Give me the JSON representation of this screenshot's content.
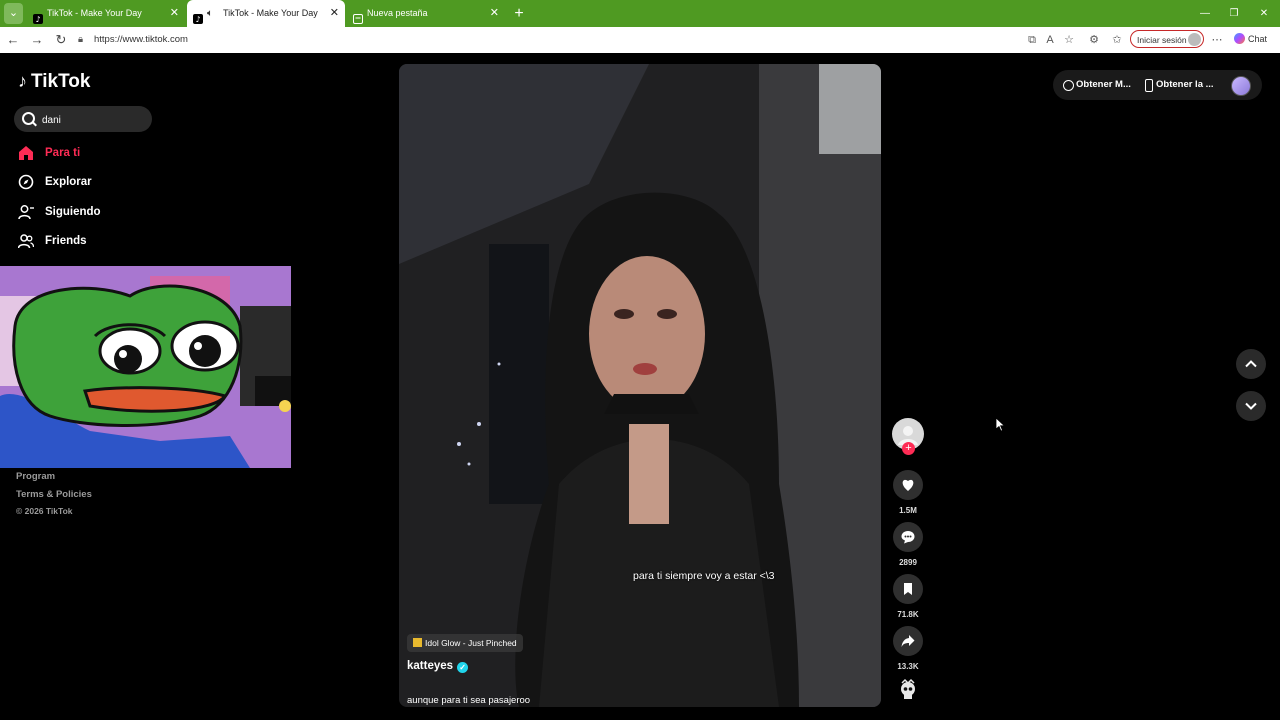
{
  "browser": {
    "tabs": [
      {
        "title": "TikTok - Make Your Day",
        "active": false
      },
      {
        "title": "TikTok - Make Your Day",
        "active": true
      },
      {
        "title": "Nueva pestaña",
        "active": false
      }
    ],
    "url": "https://www.tiktok.com",
    "signin_label": "Iniciar sesión",
    "chat_label": "Chat",
    "theme_color": "#4f9a22"
  },
  "tiktok": {
    "logo_text": "TikTok",
    "search_value": "dani",
    "nav": [
      {
        "label": "Para ti",
        "icon": "home-icon",
        "active": true
      },
      {
        "label": "Explorar",
        "icon": "compass-icon",
        "active": false
      },
      {
        "label": "Siguiendo",
        "icon": "person-icon",
        "active": false
      },
      {
        "label": "Friends",
        "icon": "friends-icon",
        "active": false
      }
    ],
    "footer": {
      "program": "Program",
      "terms": "Terms & Policies",
      "copyright": "© 2026 TikTok"
    },
    "top_buttons": {
      "get_coins": "Obtener M...",
      "get_app": "Obtener la ..."
    },
    "video": {
      "overlay_caption": "para ti siempre voy a estar <\\3",
      "music": "Idol Glow - Just Pinched",
      "author": "katteyes",
      "verified": true,
      "description": "aunque para ti sea pasajeroo",
      "likes": "1.5M",
      "comments": "2899",
      "saves": "71.8K",
      "shares": "13.3K"
    },
    "accent_color": "#fe2c55"
  }
}
